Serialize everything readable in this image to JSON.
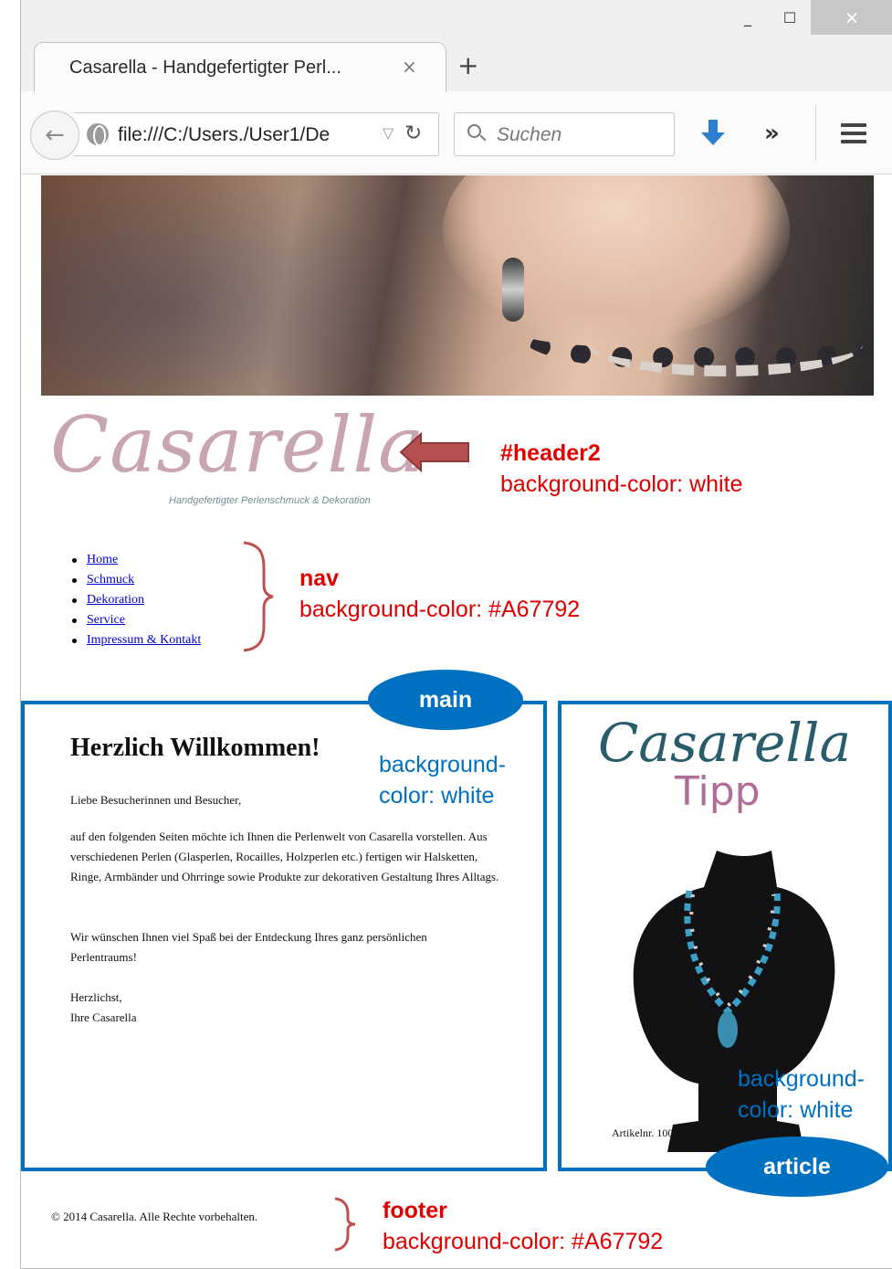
{
  "browser": {
    "tab_title": "Casarella - Handgefertigter Perl...",
    "tab_close": "×",
    "new_tab": "+",
    "url": "file:///C:/Users./User1/De",
    "search_placeholder": "Suchen",
    "window_controls": {
      "minimize": "_",
      "maximize": "☐",
      "close": "×"
    },
    "icons": [
      "back-arrow-icon",
      "globe-icon",
      "dropdown-icon",
      "reload-icon",
      "search-icon",
      "download-icon",
      "overflow-icon",
      "menu-icon"
    ]
  },
  "header": {
    "logo_text": "Casarella",
    "tagline": "Handgefertigter Perlenschmuck & Dekoration"
  },
  "nav": {
    "items": [
      "Home",
      "Schmuck",
      "Dekoration",
      "Service",
      "Impressum & Kontakt"
    ]
  },
  "main": {
    "heading": "Herzlich Willkommen!",
    "paragraphs": [
      "Liebe Besucherinnen und Besucher,",
      "auf den folgenden Seiten möchte ich Ihnen die Perlenwelt von Casarella vorstellen. Aus verschiedenen Perlen (Glasperlen, Rocailles, Holzperlen etc.) fertigen wir Halsketten, Ringe, Armbänder und Ohrringe sowie Produkte zur dekorativen Gestaltung Ihres Alltags.",
      "Wir wünschen Ihnen viel Spaß bei der Entdeckung Ihres ganz persönlichen Perlentraums!",
      "Herzlichst,",
      "Ihre Casarella"
    ]
  },
  "article": {
    "logo_text": "Casarella",
    "tipp": "Tipp",
    "article_number": "Artikelnr. 1004"
  },
  "footer": {
    "text": "© 2014 Casarella. Alle Rechte vorbehalten."
  },
  "annotations": {
    "header2": {
      "selector": "#header2",
      "style": "background-color: white"
    },
    "nav": {
      "selector": "nav",
      "style": "background-color: #A67792"
    },
    "main": {
      "label": "main",
      "style_line1": "background-",
      "style_line2": "color: white"
    },
    "article": {
      "label": "article",
      "style_line1": "background-",
      "style_line2": "color: white"
    },
    "footer": {
      "selector": "footer",
      "style": "background-color: #A67792"
    }
  },
  "colors": {
    "annotation_red": "#e00000",
    "annotation_blue": "#0070c0",
    "arrow": "#b5504f",
    "logo_pink": "#c9a4b2",
    "tipp_pink": "#b06d96"
  }
}
